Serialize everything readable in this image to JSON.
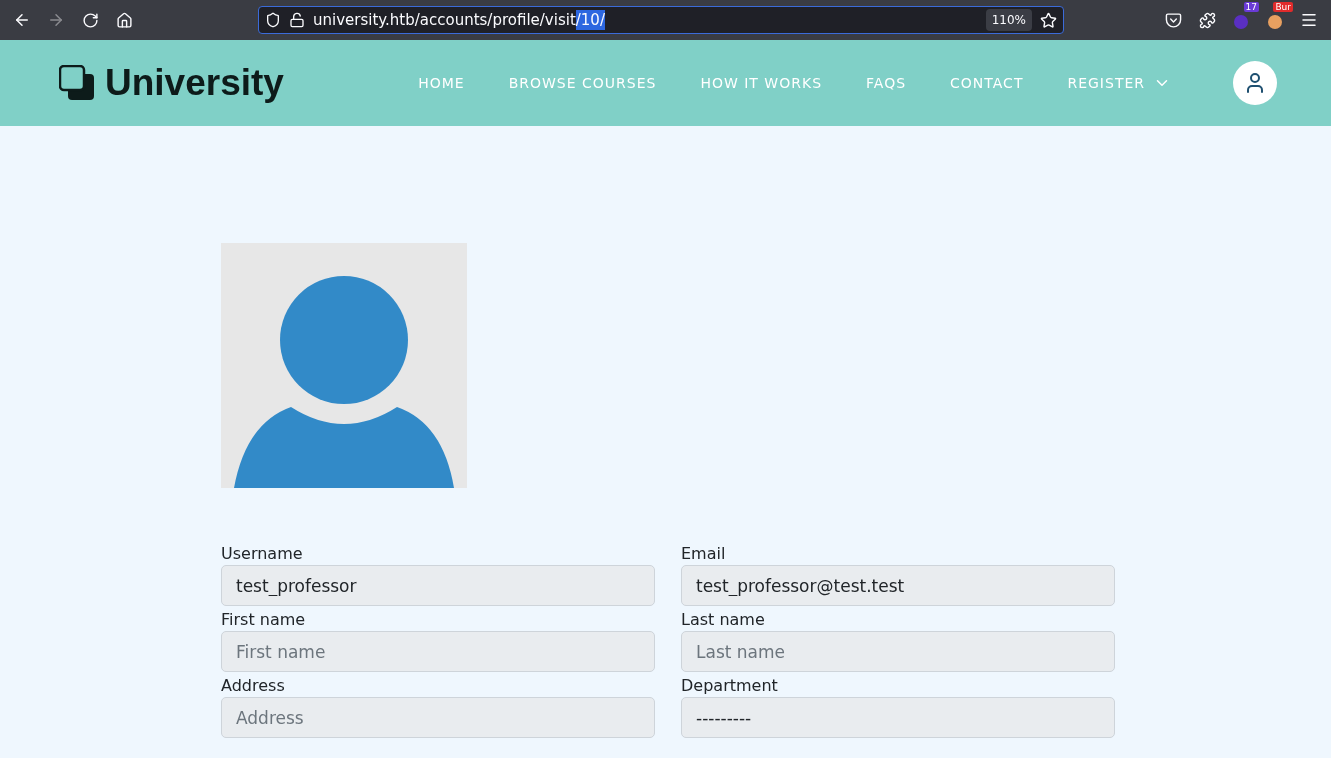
{
  "browser": {
    "url": "university.htb/accounts/profile/visit",
    "url_selected": "/10/",
    "zoom": "110%",
    "extension_badges": [
      "17",
      "Bur"
    ]
  },
  "site": {
    "logo": "University",
    "nav": [
      {
        "label": "HOME",
        "dropdown": false
      },
      {
        "label": "BROWSE COURSES",
        "dropdown": false
      },
      {
        "label": "HOW IT WORKS",
        "dropdown": false
      },
      {
        "label": "FAQS",
        "dropdown": false
      },
      {
        "label": "CONTACT",
        "dropdown": false
      },
      {
        "label": "REGISTER",
        "dropdown": true
      }
    ]
  },
  "profile": {
    "fields": [
      {
        "label": "Username",
        "value": "test_professor"
      },
      {
        "label": "Email",
        "value": "test_professor@test.test"
      },
      {
        "label": "First name",
        "placeholder": "First name"
      },
      {
        "label": "Last name",
        "placeholder": "Last name"
      },
      {
        "label": "Address",
        "placeholder": "Address"
      },
      {
        "label": "Department",
        "value": "---------"
      }
    ]
  }
}
